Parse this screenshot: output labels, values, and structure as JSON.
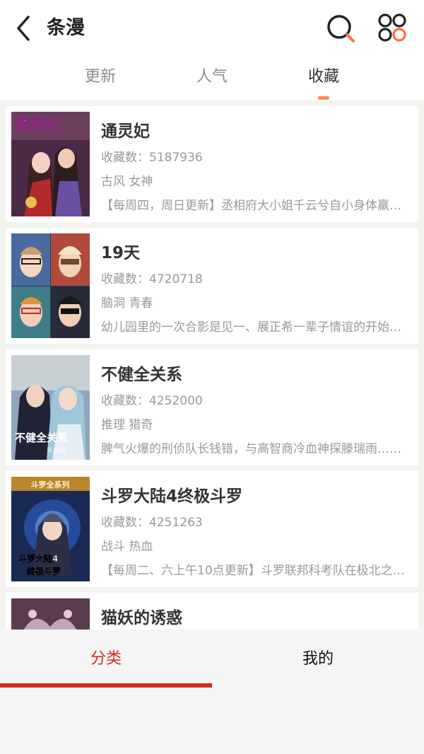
{
  "header": {
    "title": "条漫",
    "back_icon": "chevron-left-icon",
    "search_icon": "search-icon",
    "grid_icon": "grid-icon",
    "accent": "#ff6a3d"
  },
  "tabs": [
    {
      "label": "更新",
      "active": false
    },
    {
      "label": "人气",
      "active": false
    },
    {
      "label": "收藏",
      "active": true
    }
  ],
  "comics": [
    {
      "title": "通灵妃",
      "favorites": "收藏数：5187936",
      "tags": "古风 女神",
      "desc": "【每周四，周日更新】丞相府大小姐千云兮自小身体羸弱……",
      "cover_text": "通灵妃"
    },
    {
      "title": "19天",
      "favorites": "收藏数：4720718",
      "tags": "脑洞 青春",
      "desc": "幼儿园里的一次合影是见一、展正希一辈子情谊的开始……"
    },
    {
      "title": "不健全关系",
      "favorites": "收藏数：4252000",
      "tags": "推理 猎奇",
      "desc": "脾气火爆的刑侦队长钱错，与高智商冷血神探滕瑞雨……",
      "cover_text": "不健全关系",
      "cover_sub": "天启篇"
    },
    {
      "title": "斗罗大陆4终极斗罗",
      "favorites": "收藏数：4251263",
      "tags": "战斗 热血",
      "desc": "【每周二、六上午10点更新】斗罗联邦科考队在极北之地……",
      "cover_text": "斗罗大陆4",
      "cover_top": "斗罗全系列",
      "cover_sub": "终极斗罗"
    },
    {
      "title": "猫妖的诱惑",
      "favorites": "",
      "tags": "",
      "desc": ""
    }
  ],
  "bottom_nav": [
    {
      "label": "分类",
      "active": true
    },
    {
      "label": "我的",
      "active": false
    }
  ],
  "colors": {
    "active_red": "#d8281c",
    "tab_indicator": "#ff8a5b"
  }
}
